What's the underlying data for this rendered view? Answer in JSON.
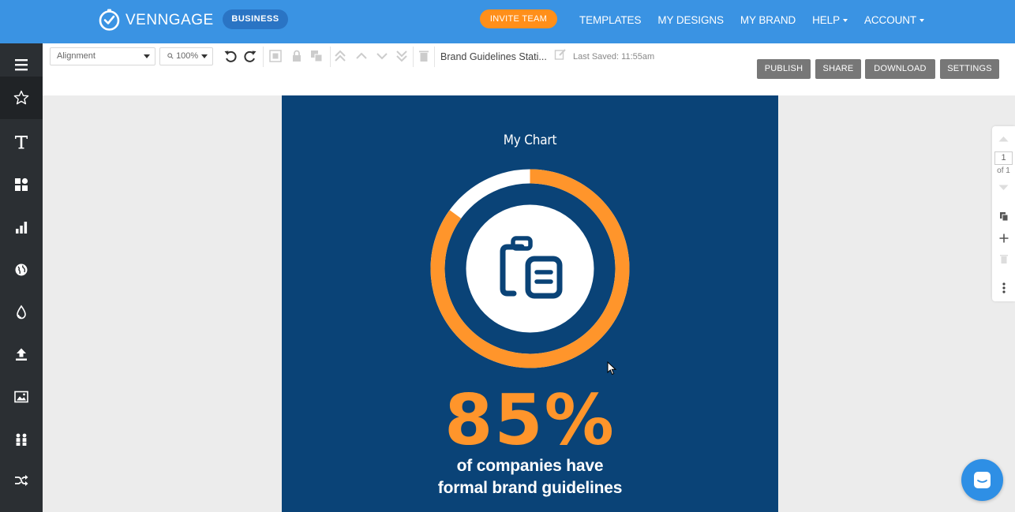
{
  "nav": {
    "brand": "VENNGAGE",
    "plan_badge": "BUSINESS",
    "invite_label": "INVITE TEAM",
    "links": [
      "TEMPLATES",
      "MY DESIGNS",
      "MY BRAND",
      "HELP",
      "ACCOUNT"
    ],
    "colors": {
      "bar": "#3a93e3",
      "invite": "#ff8f1a"
    }
  },
  "sidebar": {
    "items": [
      "menu-icon",
      "star-icon",
      "text-icon",
      "shapes-icon",
      "chart-icon",
      "globe-icon",
      "drop-icon",
      "upload-icon",
      "image-icon",
      "people-icon",
      "shuffle-icon"
    ],
    "active": "star-icon"
  },
  "toolbar": {
    "alignment_value": "Alignment",
    "zoom_value": "100%",
    "doc_title": "Brand Guidelines Stati...",
    "last_saved": "Last Saved: 11:55am",
    "publish_label": "PUBLISH",
    "share_label": "SHARE",
    "download_label": "DOWNLOAD",
    "settings_label": "SETTINGS"
  },
  "canvas": {
    "chart_title": "My Chart",
    "stat_value": "85%",
    "caption_line1": "of companies have",
    "caption_line2": "formal brand guidelines",
    "colors": {
      "background": "#0a4377",
      "accent": "#ff952b",
      "remainder": "#ffffff"
    },
    "icon": "clipboard-icon"
  },
  "chart_data": {
    "type": "pie",
    "style": "donut",
    "title": "My Chart",
    "values": [
      85,
      15
    ],
    "colors": [
      "#ff952b",
      "#ffffff"
    ]
  },
  "pages": {
    "current": "1",
    "of_label": "of 1"
  }
}
